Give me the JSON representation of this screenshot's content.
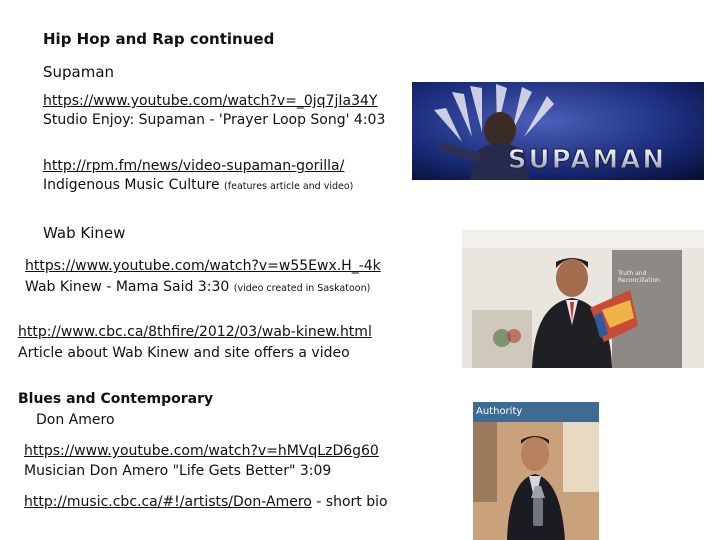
{
  "section1": {
    "heading": "Hip Hop and Rap continued",
    "artist": "Supaman",
    "link1": "https://www.youtube.com/watch?v=_0jq7jIa34Y",
    "desc1": "Studio Enjoy: Supaman - 'Prayer Loop Song' 4:03",
    "link2": "http://rpm.fm/news/video-supaman-gorilla/",
    "desc2_main": "Indigenous Music Culture",
    "desc2_note": "(features article and video)"
  },
  "section2": {
    "artist": "Wab Kinew",
    "link1": "https://www.youtube.com/watch?v=w55Ewx.H_-4k",
    "desc1_main": "Wab Kinew - Mama Said 3:30",
    "desc1_note": "(video created in Saskatoon)",
    "link2": "http://www.cbc.ca/8thfire/2012/03/wab-kinew.html",
    "desc2": "Article about Wab Kinew and site offers a video"
  },
  "section3": {
    "heading": "Blues and Contemporary",
    "artist": "Don Amero",
    "link1": "https://www.youtube.com/watch?v=hMVqLzD6g60",
    "desc1": "Musician Don Amero \"Life Gets Better\" 3:09",
    "link2": "http://music.cbc.ca/#!/artists/Don-Amero",
    "link2_suffix": " - short bio"
  },
  "images": {
    "supaman_logo_text": "SUPAMAN",
    "wab_backdrop_text": "Truth and Reconciliation",
    "don_banner_text": "Authority"
  },
  "colors": {
    "supaman_bg": "#1a2c7a",
    "supaman_accent": "#d8dcec",
    "wab_bg": "#d9d4cb",
    "don_bg": "#c9a27c"
  }
}
